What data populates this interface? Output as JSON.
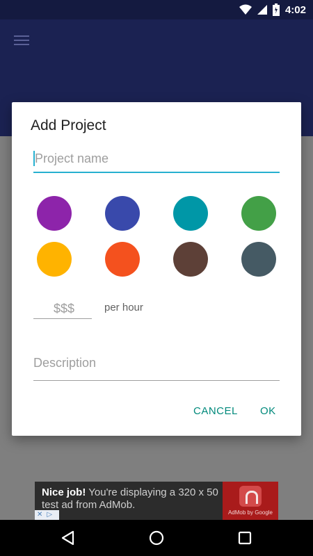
{
  "status_bar": {
    "time": "4:02"
  },
  "dialog": {
    "title": "Add Project",
    "project_name_placeholder": "Project name",
    "colors": [
      "#8d24aa",
      "#3949ab",
      "#0097a7",
      "#43a047",
      "#ffb300",
      "#f4511e",
      "#5d4037",
      "#455a64"
    ],
    "rate_placeholder": "$$$",
    "rate_suffix": "per hour",
    "description_placeholder": "Description",
    "cancel_label": "CANCEL",
    "ok_label": "OK"
  },
  "ad": {
    "headline": "Nice job!",
    "text": "You're displaying a 320 x 50 test ad from AdMob.",
    "logo_caption": "AdMob by Google"
  }
}
